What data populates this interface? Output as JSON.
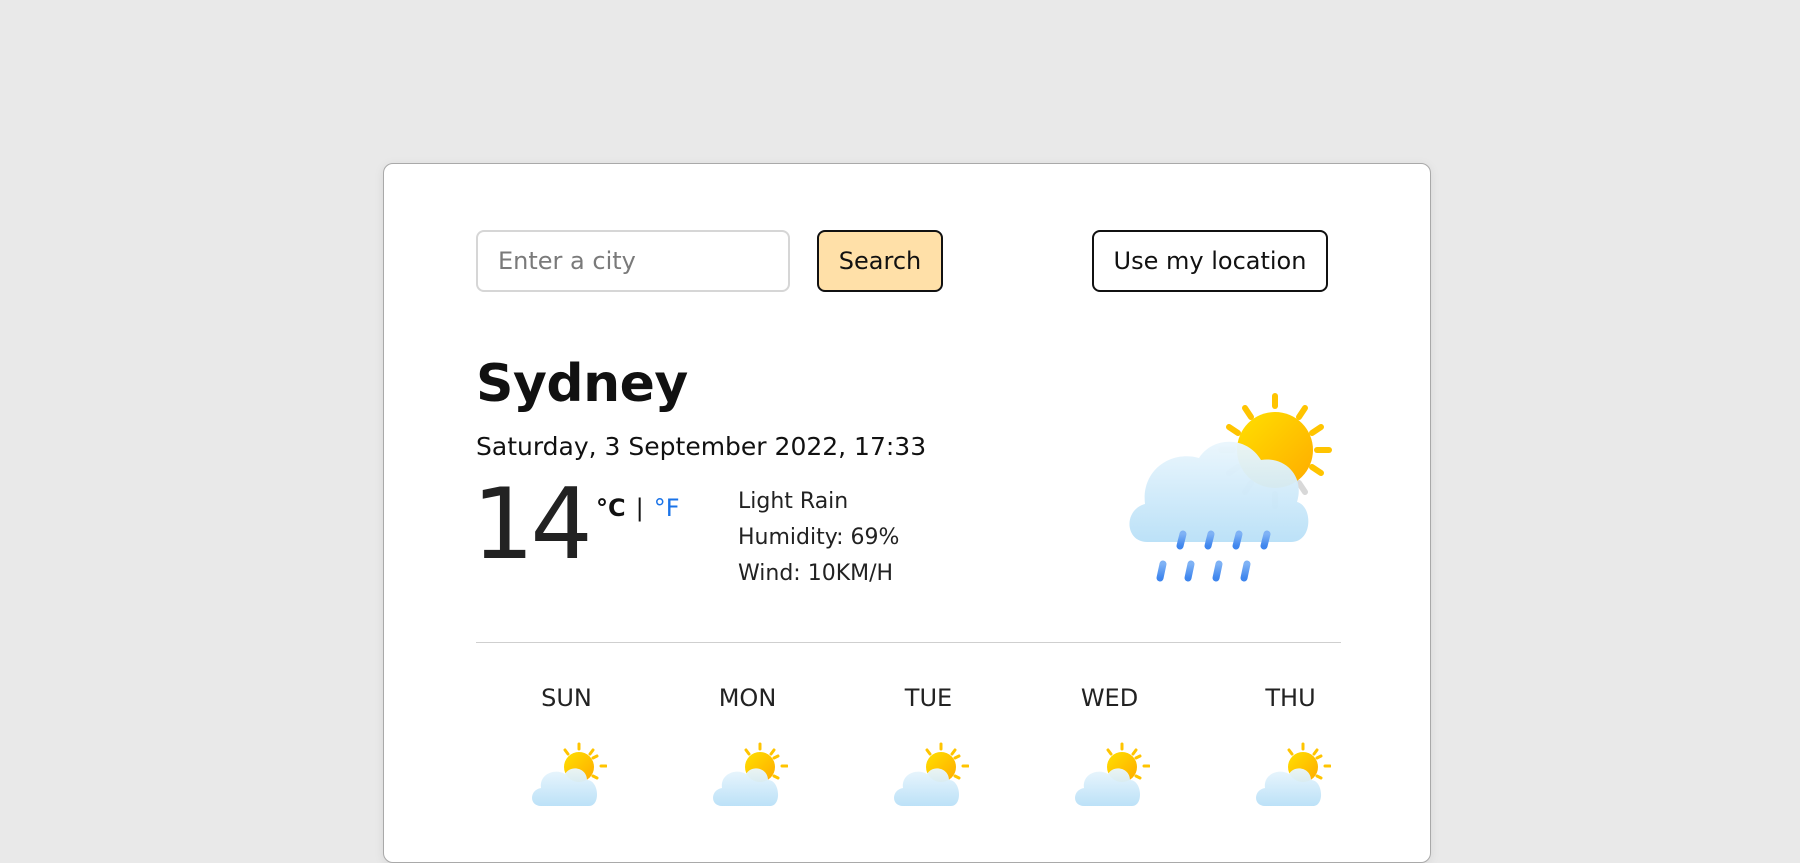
{
  "search": {
    "placeholder": "Enter a city",
    "button_label": "Search",
    "location_button_label": "Use my location"
  },
  "current": {
    "city": "Sydney",
    "datetime": "Saturday, 3 September 2022, 17:33",
    "temperature": "14",
    "unit_celsius": "°C",
    "unit_separator": "|",
    "unit_fahrenheit": "°F",
    "description": "Light Rain",
    "humidity": "Humidity: 69%",
    "wind": "Wind: 10KM/H",
    "icon": "sun-cloud-rain-icon"
  },
  "forecast": [
    {
      "day": "SUN",
      "icon": "sun-cloud-icon"
    },
    {
      "day": "MON",
      "icon": "sun-cloud-icon"
    },
    {
      "day": "TUE",
      "icon": "sun-cloud-icon"
    },
    {
      "day": "WED",
      "icon": "sun-cloud-icon"
    },
    {
      "day": "THU",
      "icon": "sun-cloud-icon"
    }
  ],
  "colors": {
    "background": "#e9e9e9",
    "search_button": "#ffe0a8",
    "fahrenheit_link": "#1a73e8",
    "sun": "#ffc400",
    "cloud": "#cfe9f8",
    "rain": "#5b9cf0"
  }
}
